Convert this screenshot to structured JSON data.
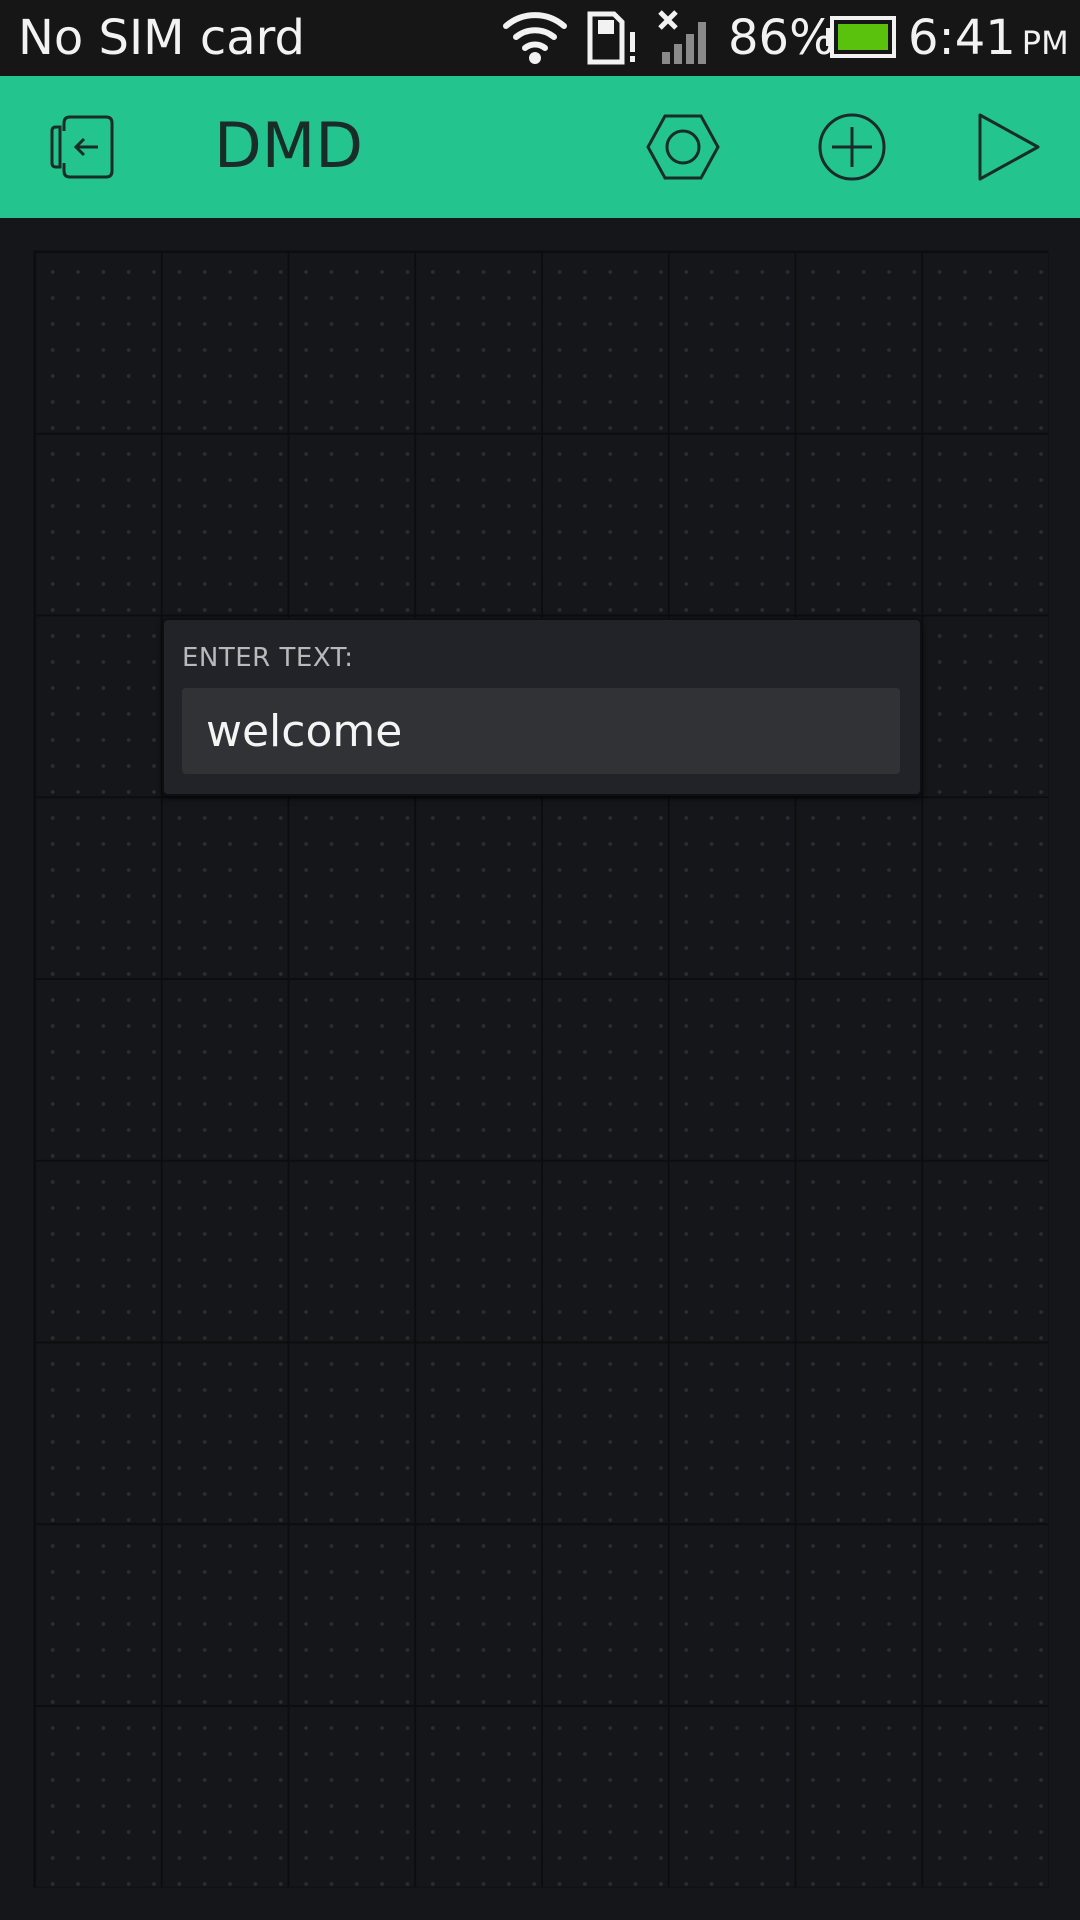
{
  "status_bar": {
    "carrier": "No SIM card",
    "battery_percent": "86%",
    "time": "6:41",
    "ampm": "PM",
    "icons": [
      "wifi-icon",
      "sd-card-warning-icon",
      "signal-no-service-icon",
      "battery-icon"
    ],
    "battery_color": "#5ac10c"
  },
  "toolbar": {
    "title": "DMD",
    "background_color": "#23c48e",
    "icons": [
      "exit-icon",
      "settings-hexagon-icon",
      "add-circle-icon",
      "play-icon"
    ]
  },
  "widget": {
    "label": "ENTER TEXT:",
    "value": "welcome",
    "type": "text-input"
  }
}
